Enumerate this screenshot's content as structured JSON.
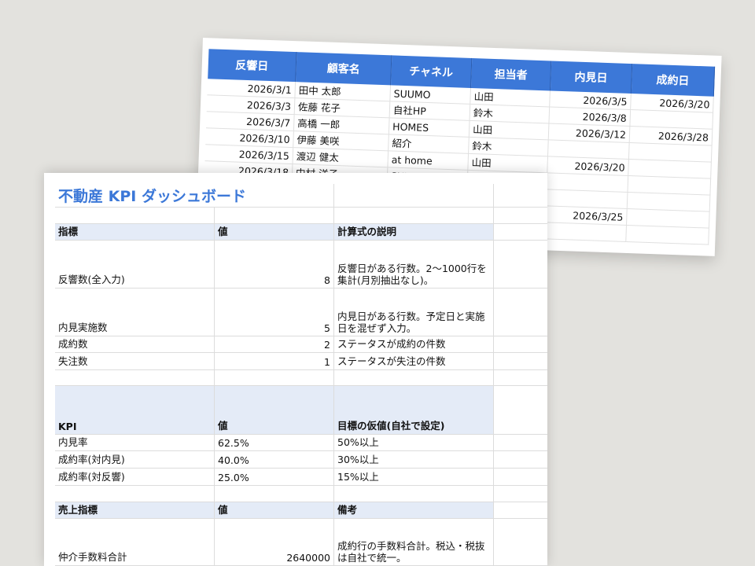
{
  "leads": {
    "headers": [
      "反響日",
      "顧客名",
      "チャネル",
      "担当者",
      "内見日",
      "成約日"
    ],
    "rows": [
      [
        "2026/3/1",
        "田中 太郎",
        "SUUMO",
        "山田",
        "2026/3/5",
        "2026/3/20"
      ],
      [
        "2026/3/3",
        "佐藤 花子",
        "自社HP",
        "鈴木",
        "2026/3/8",
        ""
      ],
      [
        "2026/3/7",
        "高橋 一郎",
        "HOMES",
        "山田",
        "2026/3/12",
        "2026/3/28"
      ],
      [
        "2026/3/10",
        "伊藤 美咲",
        "紹介",
        "鈴木",
        "",
        ""
      ],
      [
        "2026/3/15",
        "渡辺 健太",
        "at home",
        "山田",
        "2026/3/20",
        ""
      ],
      [
        "2026/3/18",
        "中村 洋子",
        "SUUMO",
        "",
        "",
        ""
      ],
      [
        "",
        "",
        "",
        "",
        "",
        ""
      ],
      [
        "",
        "",
        "",
        "",
        "2026/3/25",
        ""
      ],
      [
        "",
        "",
        "",
        "",
        "",
        ""
      ]
    ]
  },
  "dashboard": {
    "title": "不動産 KPI ダッシュボード",
    "section1": {
      "headers": [
        "指標",
        "値",
        "計算式の説明"
      ],
      "rows": [
        {
          "label": "反響数(全入力)",
          "value": "8",
          "note": "反響日がある行数。2〜1000行を集計(月別抽出なし)。"
        },
        {
          "label": "内見実施数",
          "value": "5",
          "note": "内見日がある行数。予定日と実施日を混ぜず入力。"
        },
        {
          "label": "成約数",
          "value": "2",
          "note": "ステータスが成約の件数"
        },
        {
          "label": "失注数",
          "value": "1",
          "note": "ステータスが失注の件数"
        }
      ]
    },
    "section2": {
      "headers": [
        "KPI",
        "値",
        "目標の仮値(自社で設定)"
      ],
      "rows": [
        {
          "label": "内見率",
          "value": "62.5%",
          "note": "50%以上"
        },
        {
          "label": "成約率(対内見)",
          "value": "40.0%",
          "note": "30%以上"
        },
        {
          "label": "成約率(対反響)",
          "value": "25.0%",
          "note": "15%以上"
        }
      ]
    },
    "section3": {
      "headers": [
        "売上指標",
        "値",
        "備考"
      ],
      "rows": [
        {
          "label": "仲介手数料合計",
          "value": "2640000",
          "note": "成約行の手数料合計。税込・税抜は自社で統一。"
        }
      ]
    }
  }
}
